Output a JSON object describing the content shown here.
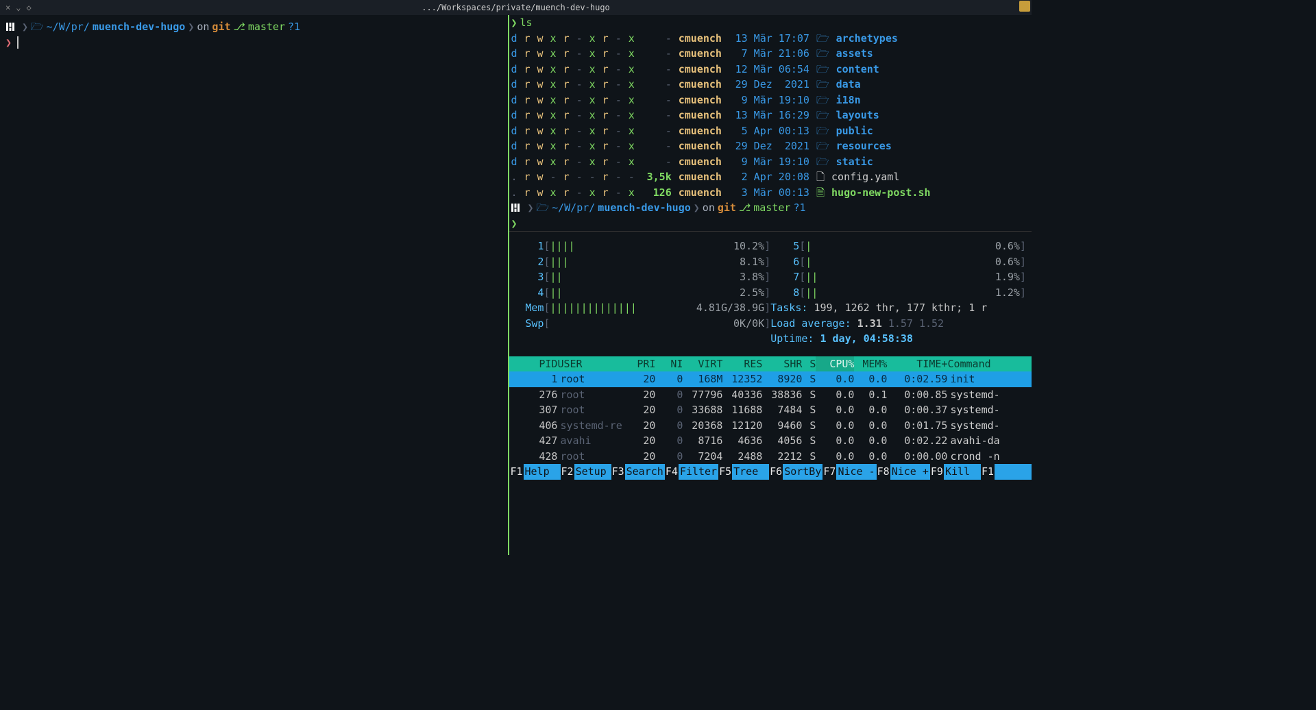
{
  "window": {
    "close": "×",
    "minimize": "⌄",
    "diamond": "◇",
    "title": ".../Workspaces/private/muench-dev-hugo"
  },
  "left_prompt": {
    "path_prefix": "~/W/pr/",
    "path_main": "muench-dev-hugo",
    "on": "on",
    "git": "git",
    "branch": "master",
    "git_status": "?1"
  },
  "right_prompt": {
    "cmd": "ls",
    "path_prefix": "~/W/pr/",
    "path_main": "muench-dev-hugo",
    "on": "on",
    "git": "git",
    "branch": "master",
    "git_status": "?1"
  },
  "ls": [
    {
      "perm": "drwxr-xr-x",
      "size": "-",
      "owner": "cmuench",
      "date": "13 Mär 17:07",
      "icon": "dir",
      "name": "archetypes"
    },
    {
      "perm": "drwxr-xr-x",
      "size": "-",
      "owner": "cmuench",
      "date": " 7 Mär 21:06",
      "icon": "dir",
      "name": "assets"
    },
    {
      "perm": "drwxr-xr-x",
      "size": "-",
      "owner": "cmuench",
      "date": "12 Mär 06:54",
      "icon": "dir",
      "name": "content"
    },
    {
      "perm": "drwxr-xr-x",
      "size": "-",
      "owner": "cmuench",
      "date": "29 Dez  2021",
      "icon": "dir",
      "name": "data"
    },
    {
      "perm": "drwxr-xr-x",
      "size": "-",
      "owner": "cmuench",
      "date": " 9 Mär 19:10",
      "icon": "dir",
      "name": "i18n"
    },
    {
      "perm": "drwxr-xr-x",
      "size": "-",
      "owner": "cmuench",
      "date": "13 Mär 16:29",
      "icon": "dir",
      "name": "layouts"
    },
    {
      "perm": "drwxr-xr-x",
      "size": "-",
      "owner": "cmuench",
      "date": " 5 Apr 00:13",
      "icon": "dir",
      "name": "public"
    },
    {
      "perm": "drwxr-xr-x",
      "size": "-",
      "owner": "cmuench",
      "date": "29 Dez  2021",
      "icon": "dir",
      "name": "resources"
    },
    {
      "perm": "drwxr-xr-x",
      "size": "-",
      "owner": "cmuench",
      "date": " 9 Mär 19:10",
      "icon": "dir",
      "name": "static"
    },
    {
      "perm": ".rw-r--r--",
      "size": "3,5k",
      "owner": "cmuench",
      "date": " 2 Apr 20:08",
      "icon": "file",
      "name": "config.yaml"
    },
    {
      "perm": ".rwxr-xr-x",
      "size": "126",
      "owner": "cmuench",
      "date": " 3 Mär 00:13",
      "icon": "sh",
      "name": "hugo-new-post.sh"
    }
  ],
  "htop": {
    "cpus": [
      {
        "n": "1",
        "bars": "||||",
        "pct": "10.2%"
      },
      {
        "n": "2",
        "bars": "|||",
        "pct": "8.1%"
      },
      {
        "n": "3",
        "bars": "||",
        "pct": "3.8%"
      },
      {
        "n": "4",
        "bars": "||",
        "pct": "2.5%"
      },
      {
        "n": "5",
        "bars": "|",
        "pct": "0.6%"
      },
      {
        "n": "6",
        "bars": "|",
        "pct": "0.6%"
      },
      {
        "n": "7",
        "bars": "||",
        "pct": "1.9%"
      },
      {
        "n": "8",
        "bars": "||",
        "pct": "1.2%"
      }
    ],
    "mem": {
      "label": "Mem",
      "bars": "||||||||||||||",
      "value": "4.81G/38.9G"
    },
    "swp": {
      "label": "Swp",
      "bars": "",
      "value": "0K/0K"
    },
    "tasks_lbl": "Tasks:",
    "tasks_val": "199, 1262 thr, 177 kthr; 1 r",
    "load_lbl": "Load average:",
    "load_vals": [
      "1.31",
      "1.57",
      "1.52"
    ],
    "uptime_lbl": "Uptime:",
    "uptime_val": "1 day, 04:58:38",
    "header": {
      "pid": "PID",
      "user": "USER",
      "pri": "PRI",
      "ni": "NI",
      "virt": "VIRT",
      "res": "RES",
      "shr": "SHR",
      "s": "S",
      "cpu": "CPU%",
      "mem": "MEM%",
      "time": "TIME+",
      "cmd": "Command"
    },
    "procs": [
      {
        "pid": "1",
        "user": "root",
        "pri": "20",
        "ni": "0",
        "virt": "168M",
        "res": "12352",
        "shr": "8920",
        "s": "S",
        "cpu": "0.0",
        "mem": "0.0",
        "time": "0:02.59",
        "cmd": "init",
        "sel": true
      },
      {
        "pid": "276",
        "user": "root",
        "pri": "20",
        "ni": "0",
        "virt": "77796",
        "res": "40336",
        "shr": "38836",
        "s": "S",
        "cpu": "0.0",
        "mem": "0.1",
        "time": "0:00.85",
        "cmd": "systemd-"
      },
      {
        "pid": "307",
        "user": "root",
        "pri": "20",
        "ni": "0",
        "virt": "33688",
        "res": "11688",
        "shr": "7484",
        "s": "S",
        "cpu": "0.0",
        "mem": "0.0",
        "time": "0:00.37",
        "cmd": "systemd-"
      },
      {
        "pid": "406",
        "user": "systemd-re",
        "pri": "20",
        "ni": "0",
        "virt": "20368",
        "res": "12120",
        "shr": "9460",
        "s": "S",
        "cpu": "0.0",
        "mem": "0.0",
        "time": "0:01.75",
        "cmd": "systemd-"
      },
      {
        "pid": "427",
        "user": "avahi",
        "pri": "20",
        "ni": "0",
        "virt": "8716",
        "res": "4636",
        "shr": "4056",
        "s": "S",
        "cpu": "0.0",
        "mem": "0.0",
        "time": "0:02.22",
        "cmd": "avahi-da"
      },
      {
        "pid": "428",
        "user": "root",
        "pri": "20",
        "ni": "0",
        "virt": "7204",
        "res": "2488",
        "shr": "2212",
        "s": "S",
        "cpu": "0.0",
        "mem": "0.0",
        "time": "0:00.00",
        "cmd": "crond -n"
      }
    ],
    "fkeys": [
      {
        "k": "F1",
        "l": "Help"
      },
      {
        "k": "F2",
        "l": "Setup"
      },
      {
        "k": "F3",
        "l": "Search"
      },
      {
        "k": "F4",
        "l": "Filter"
      },
      {
        "k": "F5",
        "l": "Tree"
      },
      {
        "k": "F6",
        "l": "SortBy"
      },
      {
        "k": "F7",
        "l": "Nice -"
      },
      {
        "k": "F8",
        "l": "Nice +"
      },
      {
        "k": "F9",
        "l": "Kill"
      },
      {
        "k": "F1",
        "l": ""
      }
    ]
  }
}
